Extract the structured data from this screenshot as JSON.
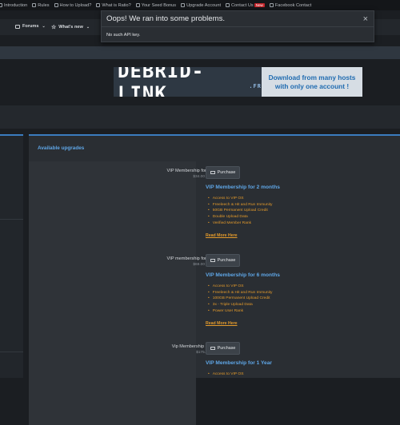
{
  "topbar": {
    "items": [
      {
        "label": "Introduction",
        "icon": "home-icon"
      },
      {
        "label": "Rules",
        "icon": "rules-icon"
      },
      {
        "label": "How to Upload?",
        "icon": "upload-icon"
      },
      {
        "label": "What is Ratio?",
        "icon": "ratio-icon"
      },
      {
        "label": "Your Seed Bonus",
        "icon": "bonus-icon"
      },
      {
        "label": "Upgrade Account",
        "icon": "upgrade-icon"
      },
      {
        "label": "Contact Us",
        "icon": "contact-icon",
        "badge": "New"
      },
      {
        "label": "Facebook Contact",
        "icon": "facebook-icon"
      }
    ]
  },
  "nav": {
    "forums": "Forums",
    "whats_new": "What's new"
  },
  "banner": {
    "logo_text": "DEBRID-LINK",
    "logo_suffix": ".FR",
    "slogan_line1": "Download from many hosts",
    "slogan_line2": "with only one account !"
  },
  "modal": {
    "title": "Oops! We ran into some problems.",
    "message": "No such API key.",
    "close": "×"
  },
  "upgrades": {
    "heading": "Available upgrades",
    "purchase_label": "Purchase",
    "read_more": "Read More Here",
    "plans": [
      {
        "name": "VIP Membership for 2 months:",
        "price": "$34.00 for 2 months",
        "title": "VIP Membership for 2 months",
        "features": [
          "Access to VIP OS",
          "Freeleech & Hit and Run Immunity",
          "50GB Permanent Upload Credit",
          "Double Upload Data",
          "Verified Member Rank"
        ]
      },
      {
        "name": "VIP membership for 6 Months:",
        "price": "$69.00 for 6 months",
        "title": "VIP Membership for 6 months",
        "features": [
          "Access to VIP OS",
          "Freeleech & Hit and Run Immunity",
          "100GB Permanent Upload Credit",
          "3x - Triple Upload Data",
          "Power User Rank"
        ]
      },
      {
        "name": "Vip Membership For 1 Year:",
        "price": "$175.00 for 1 year",
        "title": "VIP Membership for 1 Year",
        "features": [
          "Access to VIP OS"
        ]
      }
    ]
  }
}
